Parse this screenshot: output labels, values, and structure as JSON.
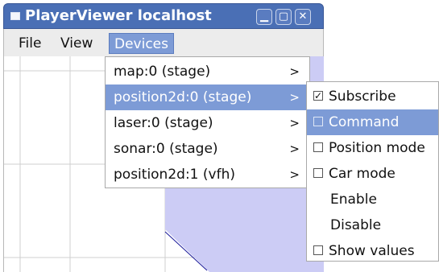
{
  "window": {
    "title": "PlayerViewer localhost"
  },
  "menubar": {
    "file": "File",
    "view": "View",
    "devices": "Devices"
  },
  "devices_menu": [
    {
      "label": "map:0 (stage)",
      "arrow": ">"
    },
    {
      "label": "position2d:0 (stage)",
      "arrow": ">"
    },
    {
      "label": "laser:0 (stage)",
      "arrow": ">"
    },
    {
      "label": "sonar:0 (stage)",
      "arrow": ">"
    },
    {
      "label": "position2d:1 (vfh)",
      "arrow": ">"
    }
  ],
  "submenu": [
    {
      "label": "Subscribe",
      "checkbox": true,
      "checked": true
    },
    {
      "label": "Command",
      "checkbox": true,
      "checked": false
    },
    {
      "label": "Position mode",
      "checkbox": true,
      "checked": false
    },
    {
      "label": "Car mode",
      "checkbox": true,
      "checked": false
    },
    {
      "label": "Enable",
      "checkbox": false
    },
    {
      "label": "Disable",
      "checkbox": false
    },
    {
      "label": "Show values",
      "checkbox": true,
      "checked": false
    }
  ],
  "check_glyph": "✓",
  "colors": {
    "titlebar": "#4a6fb5",
    "highlight": "#7d9bd6",
    "stage_fill": "#ccccf5",
    "grid": "#cfcfcf"
  }
}
